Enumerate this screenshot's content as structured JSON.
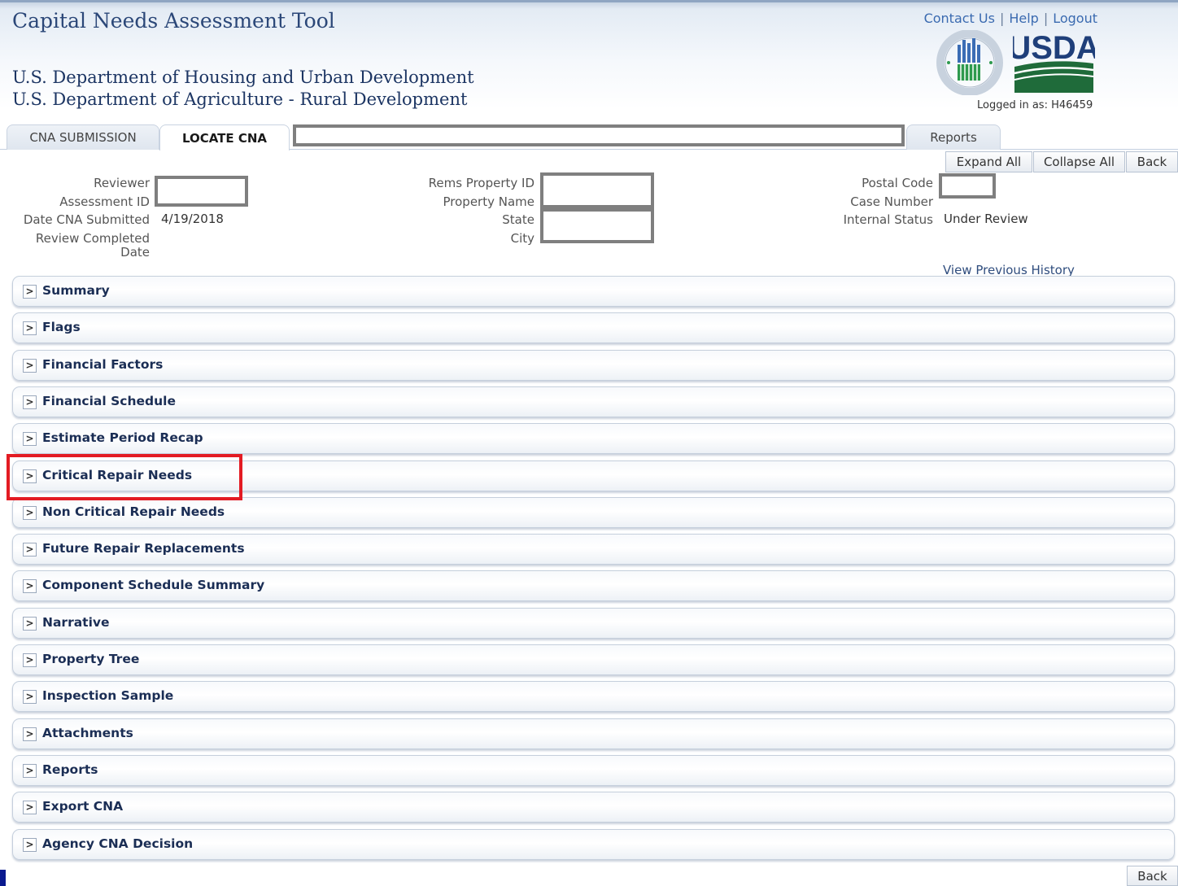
{
  "header": {
    "app_title": "Capital Needs Assessment Tool",
    "dept_line1": "U.S. Department of Housing and Urban Development",
    "dept_line2": "U.S. Department of Agriculture - Rural Development",
    "links": {
      "contact": "Contact Us",
      "help": "Help",
      "logout": "Logout",
      "separator": "|"
    },
    "usda_logo_text": "USDA",
    "logged_in": "Logged in as: H46459"
  },
  "tabs": {
    "cna_submission": "CNA SUBMISSION",
    "locate_cna": "LOCATE CNA",
    "reports": "Reports"
  },
  "actions": {
    "expand_all": "Expand All",
    "collapse_all": "Collapse All",
    "back": "Back"
  },
  "info": {
    "reviewer_label": "Reviewer",
    "assessment_id_label": "Assessment ID",
    "date_submitted_label": "Date CNA Submitted",
    "date_submitted_value": "4/19/2018",
    "review_completed_label_1": "Review Completed",
    "review_completed_label_2": "Date",
    "rems_label": "Rems Property ID",
    "property_name_label": "Property Name",
    "state_label": "State",
    "city_label": "City",
    "postal_code_label": "Postal Code",
    "case_number_label": "Case Number",
    "internal_status_label": "Internal Status",
    "internal_status_value": "Under Review",
    "view_history": "View Previous History"
  },
  "sections": [
    "Summary",
    "Flags",
    "Financial Factors",
    "Financial Schedule",
    "Estimate Period Recap",
    "Critical Repair Needs",
    "Non Critical Repair Needs",
    "Future Repair Replacements",
    "Component Schedule Summary",
    "Narrative",
    "Property Tree",
    "Inspection Sample",
    "Attachments",
    "Reports",
    "Export CNA",
    "Agency CNA Decision"
  ],
  "chevron_glyph": ">",
  "highlighted_section": "Critical Repair Needs",
  "colors": {
    "highlight": "#e31b23",
    "link": "#3a6ab0",
    "section_text": "#1b2e55"
  }
}
